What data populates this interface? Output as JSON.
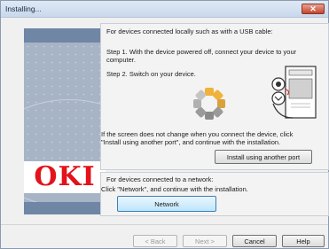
{
  "window": {
    "title": "Installing...",
    "close_glyph": "✕"
  },
  "logo": {
    "text": "OKI",
    "color": "#e3121b"
  },
  "usb_section": {
    "heading": "For devices connected locally such as with a USB cable:",
    "step1_line1": "Step 1. With the device powered off, connect your device to your",
    "step1_line2": "computer.",
    "step2": "Step 2. Switch on your device.",
    "hint_line1": "If the screen does not change when you connect the device, click",
    "hint_line2": "\"Install using another port\", and continue with the installation.",
    "another_port_button": "Install using another port"
  },
  "network_section": {
    "heading": "For devices connected to a network:",
    "instruction": "Click \"Network\", and continue with the installation.",
    "network_button": "Network"
  },
  "footer": {
    "back": "< Back",
    "next": "Next >",
    "cancel": "Cancel",
    "help": "Help"
  },
  "icons": {
    "spinner": "loading-spinner-icon",
    "device": "usb-printer-icon",
    "close": "close-icon"
  }
}
